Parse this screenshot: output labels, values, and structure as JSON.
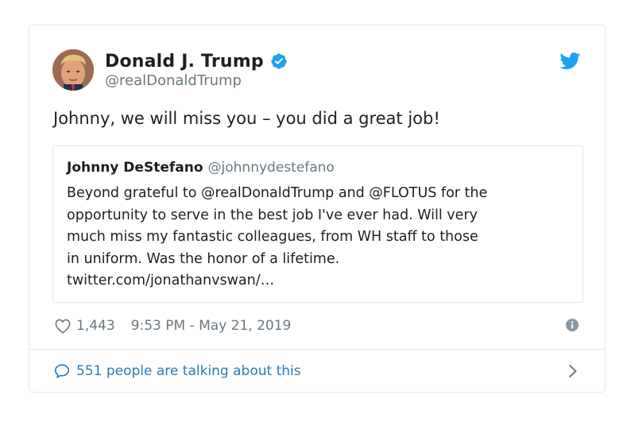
{
  "author": {
    "name": "Donald J. Trump",
    "handle": "@realDonaldTrump",
    "verified": true,
    "avatar_icon": "profile-photo"
  },
  "tweet": {
    "text": "Johnny, we will miss you – you did a great job!"
  },
  "quoted_tweet": {
    "name": "Johnny DeStefano",
    "handle": "@johnnydestefano",
    "text": "Beyond grateful to @realDonaldTrump and @FLOTUS for the\nopportunity to serve in the best job I've ever had.  Will very\nmuch miss my fantastic colleagues, from WH staff to those\nin uniform. Was the honor of a lifetime.\ntwitter.com/jonathanvswan/…"
  },
  "meta": {
    "likes": "1,443",
    "timestamp": "9:53 PM - May 21, 2019"
  },
  "conversation": {
    "label": "551 people are talking about this"
  },
  "icons": {
    "brand": "twitter-bird-icon",
    "verified": "verified-badge-icon",
    "like": "heart-icon",
    "info": "info-icon",
    "reply": "speech-bubble-icon",
    "more": "chevron-right-icon"
  },
  "colors": {
    "twitter_blue": "#1da1f2",
    "link_blue": "#2b7bb9",
    "text": "#1c2022",
    "muted": "#697882",
    "border": "#e1e8ed"
  }
}
